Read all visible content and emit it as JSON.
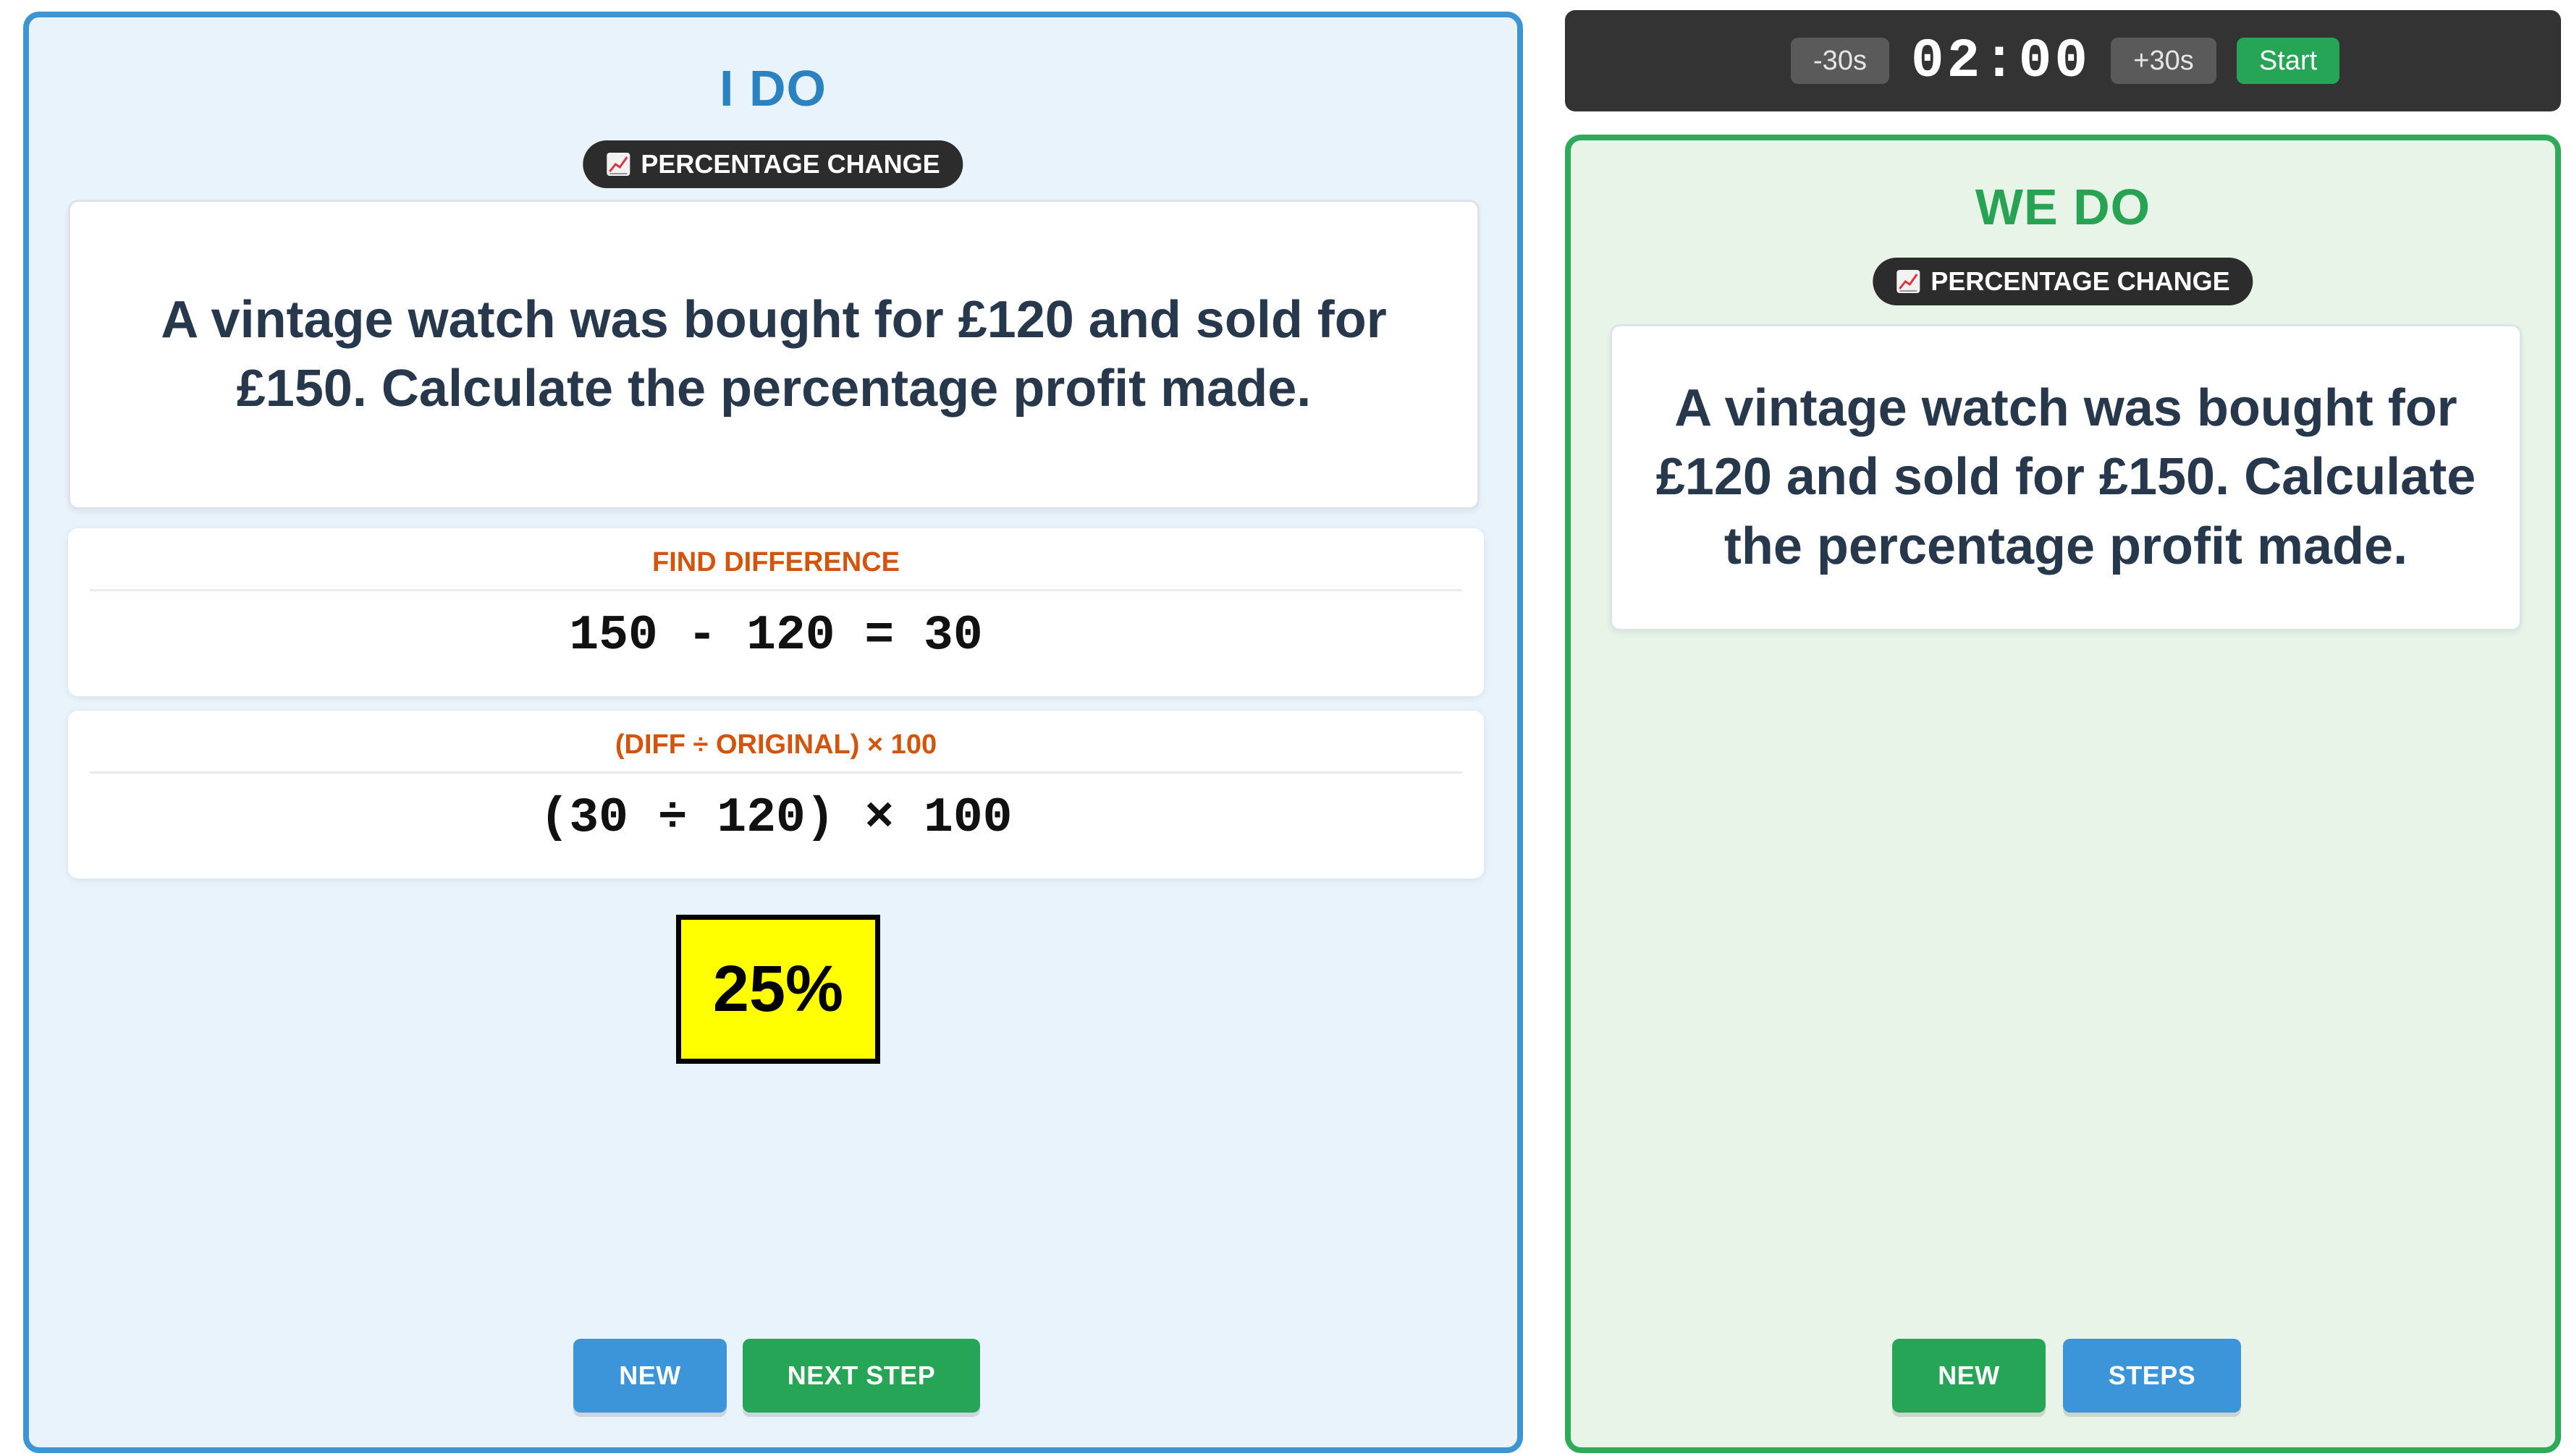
{
  "timer": {
    "minus_label": "-30s",
    "display": "02:00",
    "plus_label": "+30s",
    "start_label": "Start"
  },
  "i_do": {
    "title": "I DO",
    "topic": "PERCENTAGE CHANGE",
    "topic_icon": "chart-increasing-icon",
    "question": "A vintage watch was bought for £120 and sold for £150. Calculate the percentage profit made.",
    "steps": [
      {
        "label": "FIND DIFFERENCE",
        "expression": "150 - 120 = 30"
      },
      {
        "label": "(DIFF ÷ ORIGINAL) × 100",
        "expression": "(30 ÷ 120) × 100"
      }
    ],
    "answer": "25%",
    "buttons": {
      "new": "NEW",
      "next_step": "NEXT STEP"
    }
  },
  "we_do": {
    "title": "WE DO",
    "topic": "PERCENTAGE CHANGE",
    "topic_icon": "chart-increasing-icon",
    "question": "A vintage watch was bought for £120 and sold for £150. Calculate the percentage profit made.",
    "buttons": {
      "new": "NEW",
      "steps": "STEPS"
    }
  },
  "colors": {
    "i_do_accent": "#3d95d4",
    "we_do_accent": "#2eaa5a",
    "step_label": "#d3540c",
    "answer_highlight": "#ffff00"
  }
}
